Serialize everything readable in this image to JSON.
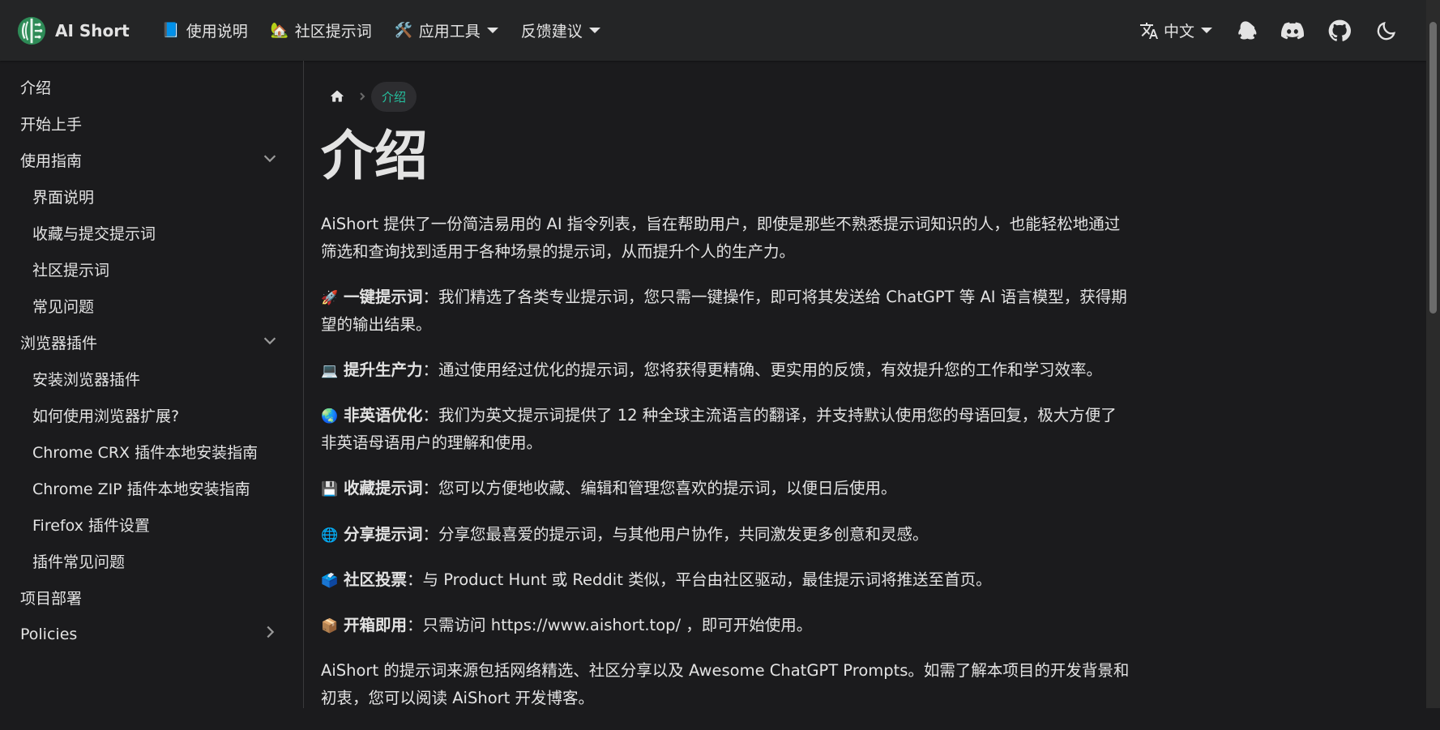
{
  "navbar": {
    "brand": "AI Short",
    "items": [
      {
        "emoji": "📘",
        "label": "使用说明",
        "dropdown": false
      },
      {
        "emoji": "🏡",
        "label": "社区提示词",
        "dropdown": false
      },
      {
        "emoji": "🛠️",
        "label": "应用工具",
        "dropdown": true
      },
      {
        "emoji": "",
        "label": "反馈建议",
        "dropdown": true
      }
    ],
    "language": "中文"
  },
  "sidebar": {
    "items": [
      {
        "label": "介绍",
        "level": 0
      },
      {
        "label": "开始上手",
        "level": 0
      },
      {
        "label": "使用指南",
        "level": 0,
        "chevron": "down"
      },
      {
        "label": "界面说明",
        "level": 1
      },
      {
        "label": "收藏与提交提示词",
        "level": 1
      },
      {
        "label": "社区提示词",
        "level": 1
      },
      {
        "label": "常见问题",
        "level": 1
      },
      {
        "label": "浏览器插件",
        "level": 0,
        "chevron": "down"
      },
      {
        "label": "安装浏览器插件",
        "level": 1
      },
      {
        "label": "如何使用浏览器扩展?",
        "level": 1
      },
      {
        "label": "Chrome CRX 插件本地安装指南",
        "level": 1
      },
      {
        "label": "Chrome ZIP 插件本地安装指南",
        "level": 1
      },
      {
        "label": "Firefox 插件设置",
        "level": 1
      },
      {
        "label": "插件常见问题",
        "level": 1
      },
      {
        "label": "项目部署",
        "level": 0
      },
      {
        "label": "Policies",
        "level": 0,
        "chevron": "right"
      }
    ]
  },
  "breadcrumb": {
    "current": "介绍"
  },
  "page": {
    "title": "介绍",
    "intro": "AiShort 提供了一份简洁易用的 AI 指令列表，旨在帮助用户，即使是那些不熟悉提示词知识的人，也能轻松地通过筛选和查询找到适用于各种场景的提示词，从而提升个人的生产力。",
    "features": [
      {
        "emoji": "🚀",
        "title": "一键提示词",
        "text": "：我们精选了各类专业提示词，您只需一键操作，即可将其发送给 ChatGPT 等 AI 语言模型，获得期望的输出结果。"
      },
      {
        "emoji": "💻",
        "title": "提升生产力",
        "text": "：通过使用经过优化的提示词，您将获得更精确、更实用的反馈，有效提升您的工作和学习效率。"
      },
      {
        "emoji": "🌏",
        "title": "非英语优化",
        "text": "：我们为英文提示词提供了 12 种全球主流语言的翻译，并支持默认使用您的母语回复，极大方便了非英语母语用户的理解和使用。"
      },
      {
        "emoji": "💾",
        "title": "收藏提示词",
        "text": "：您可以方便地收藏、编辑和管理您喜欢的提示词，以便日后使用。"
      },
      {
        "emoji": "🌐",
        "title": "分享提示词",
        "text": "：分享您最喜爱的提示词，与其他用户协作，共同激发更多创意和灵感。"
      },
      {
        "emoji": "🗳️",
        "title": "社区投票",
        "text": "：与 Product Hunt 或 Reddit 类似，平台由社区驱动，最佳提示词将推送至首页。"
      },
      {
        "emoji": "📦",
        "title": "开箱即用",
        "text": "：只需访问 https://www.aishort.top/ ，即可开始使用。"
      }
    ],
    "outro": "AiShort 的提示词来源包括网络精选、社区分享以及 Awesome ChatGPT Prompts。如需了解本项目的开发背景和初衷，您可以阅读 AiShort 开发博客。"
  }
}
